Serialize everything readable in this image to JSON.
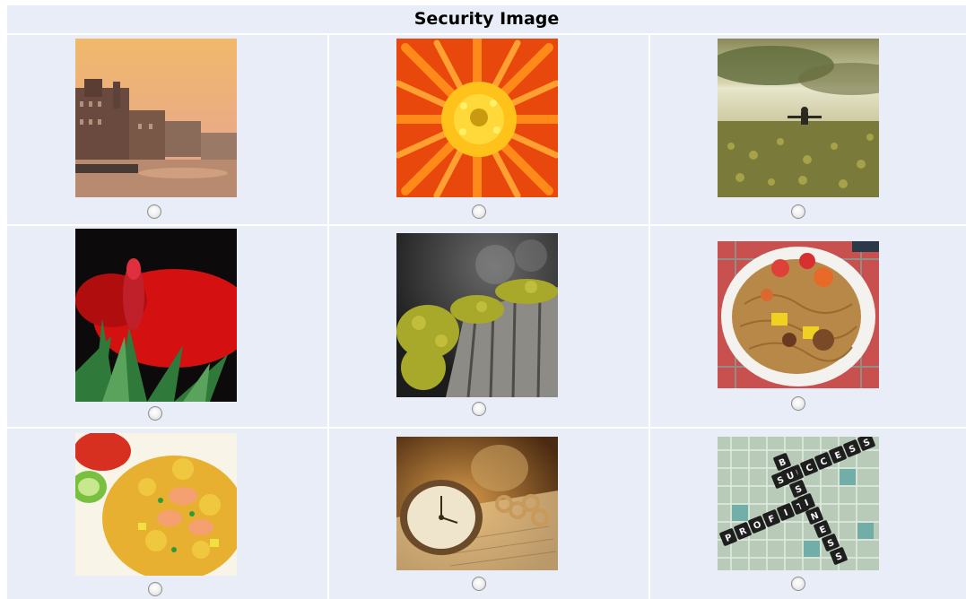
{
  "header": {
    "title": "Security Image"
  },
  "images": [
    {
      "name": "city-canal",
      "selected": false
    },
    {
      "name": "orange-flower",
      "selected": false
    },
    {
      "name": "field-person",
      "selected": false
    },
    {
      "name": "red-tulip",
      "selected": false
    },
    {
      "name": "mossy-stump",
      "selected": false
    },
    {
      "name": "noodle-plate",
      "selected": false
    },
    {
      "name": "fried-rice",
      "selected": false
    },
    {
      "name": "pocket-watch",
      "selected": false
    },
    {
      "name": "scrabble-board",
      "selected": false
    }
  ],
  "scrabble": {
    "across_1": "SUCCESS",
    "across_2": "PROFIT",
    "down": "BUSINESS"
  },
  "colors": {
    "panel_bg": "#e8edf7",
    "separator": "#ffffff"
  }
}
